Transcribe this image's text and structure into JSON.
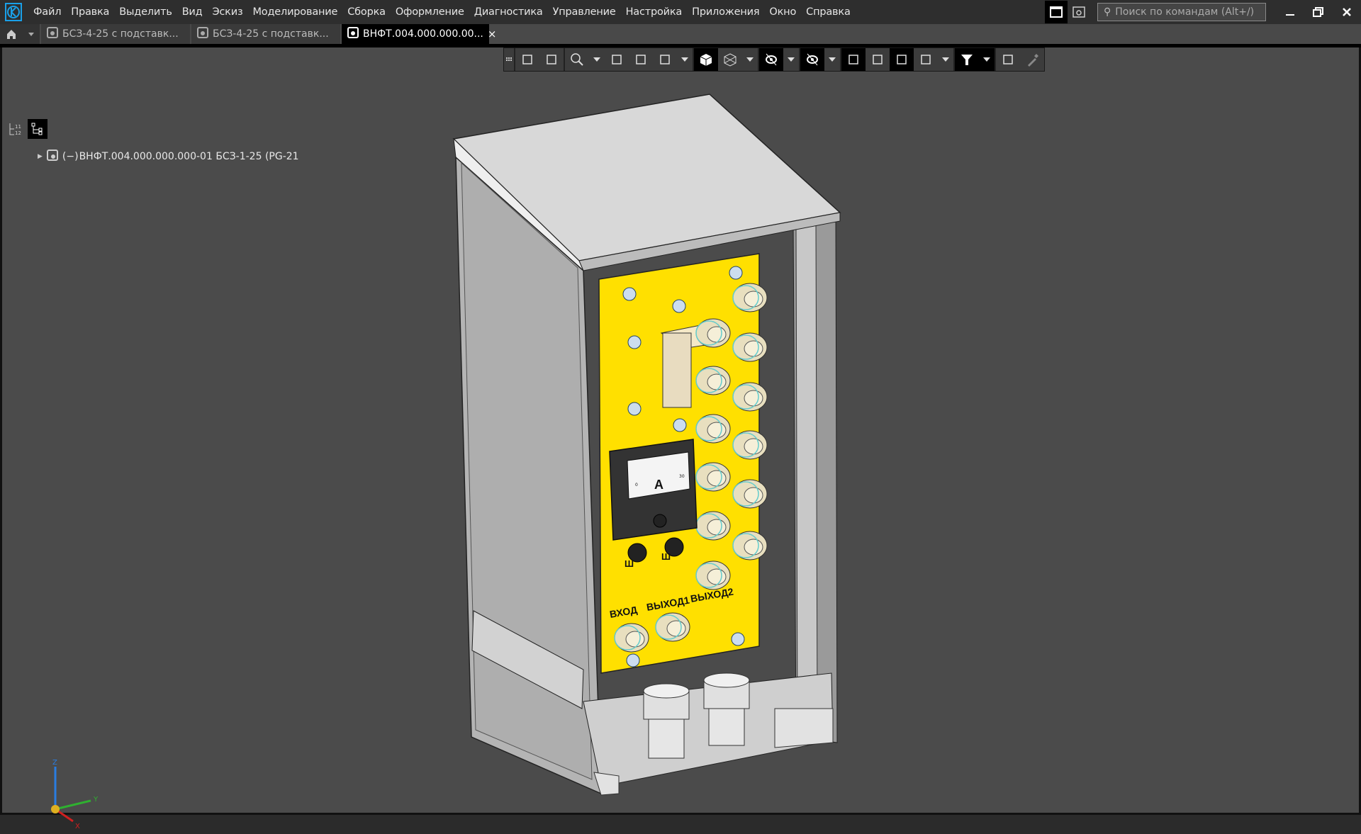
{
  "app": {
    "logo": "kompas-logo",
    "accent": "#1aa0e8"
  },
  "menu": [
    "Файл",
    "Правка",
    "Выделить",
    "Вид",
    "Эскиз",
    "Моделирование",
    "Сборка",
    "Оформление",
    "Диагностика",
    "Управление",
    "Настройка",
    "Приложения",
    "Окно",
    "Справка"
  ],
  "search": {
    "placeholder": "Поиск по командам (Alt+/)"
  },
  "tabs": [
    {
      "label": "БСЗ-4-25 с подставк...",
      "active": false
    },
    {
      "label": "БСЗ-4-25 с подставк...",
      "active": false
    },
    {
      "label": "ВНФТ.004.000.000.00...",
      "active": true,
      "close": "×"
    }
  ],
  "toolbar": {
    "icons": [
      "grip",
      "sketch-icon",
      "part-properties-icon",
      "zoom-window-icon",
      "dropdown",
      "normal-to-icon",
      "rotate-icon",
      "orientation-icon",
      "dropdown",
      "shaded-cube-icon",
      "wireframe-cube-icon",
      "dropdown",
      "hide-icon",
      "dropdown",
      "show-only-icon",
      "dropdown",
      "snap-icon",
      "section-icon",
      "cut-view-icon",
      "measure-icon",
      "dropdown",
      "filter-icon",
      "dropdown",
      "crane-icon",
      "eyedropper-icon"
    ]
  },
  "tree": {
    "item": "ВНФТ.004.000.000.000-01 БСЗ-1-25 (PG-21",
    "state": "(−)"
  },
  "model": {
    "panel_color": "#ffe000",
    "labels": {
      "input": "ВХОД",
      "out1": "ВЫХОД1",
      "out2": "ВЫХОД2",
      "sh1": "Ш",
      "sh2": "Ш",
      "meter": "A",
      "meter_min": "0",
      "meter_max": "30"
    }
  },
  "axes": {
    "x": "X",
    "y": "Y",
    "z": "Z"
  }
}
